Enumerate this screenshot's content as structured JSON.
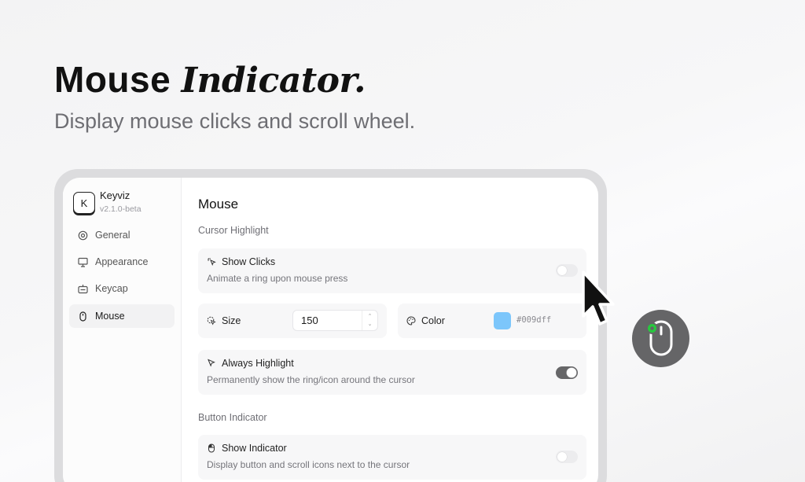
{
  "hero": {
    "title_plain": "Mouse",
    "title_italic": "Indicator.",
    "subtitle": "Display mouse clicks and scroll wheel."
  },
  "app": {
    "logo_letter": "K",
    "name": "Keyviz",
    "version": "v2.1.0-beta"
  },
  "sidebar": {
    "items": [
      {
        "label": "General",
        "icon": "gear-icon",
        "active": false
      },
      {
        "label": "Appearance",
        "icon": "monitor-icon",
        "active": false
      },
      {
        "label": "Keycap",
        "icon": "keyboard-icon",
        "active": false
      },
      {
        "label": "Mouse",
        "icon": "mouse-icon",
        "active": true
      }
    ]
  },
  "main": {
    "title": "Mouse",
    "cursor_section": "Cursor Highlight",
    "show_clicks": {
      "title": "Show Clicks",
      "description": "Animate a ring upon mouse press",
      "enabled": false
    },
    "size": {
      "label": "Size",
      "value": "150"
    },
    "color": {
      "label": "Color",
      "value": "#009dff",
      "swatch": "#7cc6fb"
    },
    "always_highlight": {
      "title": "Always Highlight",
      "description": "Permanently show the ring/icon around the cursor",
      "enabled": true
    },
    "button_section": "Button Indicator",
    "show_indicator": {
      "title": "Show Indicator",
      "description": "Display button and scroll icons next to the cursor",
      "enabled": false
    }
  },
  "colors": {
    "toggle_on": "#666668",
    "badge": "#656567",
    "click_dot": "#27c93f"
  }
}
